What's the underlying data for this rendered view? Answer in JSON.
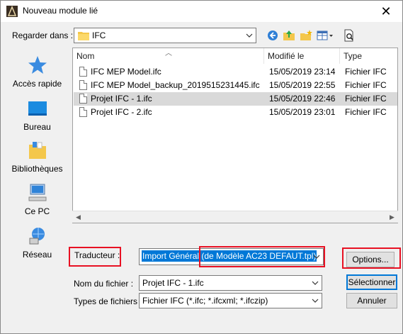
{
  "window": {
    "title": "Nouveau module lié",
    "close_glyph": "✕"
  },
  "lookin": {
    "label": "Regarder dans :",
    "value": "IFC"
  },
  "places": [
    {
      "label": "Accès rapide",
      "icon": "star-icon"
    },
    {
      "label": "Bureau",
      "icon": "desktop-icon"
    },
    {
      "label": "Bibliothèques",
      "icon": "library-icon"
    },
    {
      "label": "Ce PC",
      "icon": "computer-icon"
    },
    {
      "label": "Réseau",
      "icon": "network-icon"
    }
  ],
  "columns": {
    "name": "Nom",
    "modified": "Modifié le",
    "type": "Type"
  },
  "files": [
    {
      "name": "IFC MEP Model.ifc",
      "modified": "15/05/2019 23:14",
      "type": "Fichier IFC",
      "selected": false
    },
    {
      "name": "IFC MEP Model_backup_2019515231445.ifc",
      "modified": "15/05/2019 22:55",
      "type": "Fichier IFC",
      "selected": false
    },
    {
      "name": "Projet IFC - 1.ifc",
      "modified": "15/05/2019 22:46",
      "type": "Fichier IFC",
      "selected": true
    },
    {
      "name": "Projet IFC - 2.ifc",
      "modified": "15/05/2019 23:01",
      "type": "Fichier IFC",
      "selected": false
    }
  ],
  "translator": {
    "label": "Traducteur :",
    "value": "Import Général (de Modèle AC23 DEFAUT.tpl)"
  },
  "filename": {
    "label": "Nom du fichier :",
    "value": "Projet IFC - 1.ifc"
  },
  "filetype": {
    "label": "Types de fichiers :",
    "value": "Fichier IFC (*.ifc; *.ifcxml; *.ifczip)"
  },
  "buttons": {
    "options": "Options...",
    "select": "Sélectionner",
    "cancel": "Annuler"
  },
  "colors": {
    "accent": "#0078d7",
    "highlight_red": "#e81123",
    "selected_row": "#d9d9d9"
  }
}
